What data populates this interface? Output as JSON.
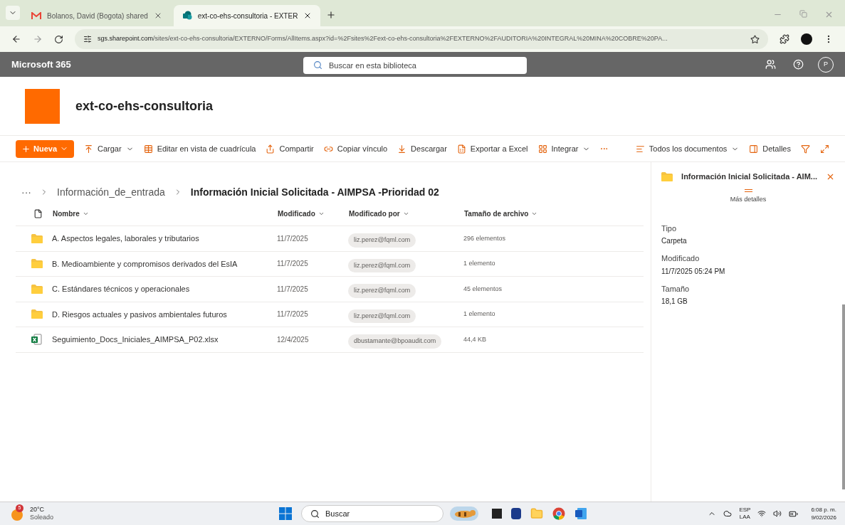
{
  "browser": {
    "tabs": [
      {
        "title": "Bolanos, David (Bogota) shared",
        "kind": "mail",
        "selected": false
      },
      {
        "title": "ext-co-ehs-consultoria - EXTER",
        "kind": "sharepoint",
        "selected": true
      }
    ],
    "url_host": "sgs.sharepoint.com",
    "url_path": "/sites/ext-co-ehs-consultoria/EXTERNO/Forms/AllItems.aspx?id=%2Fsites%2Fext-co-ehs-consultoria%2FEXTERNO%2FAUDITORIA%20INTEGRAL%20MINA%20COBRE%20PA..."
  },
  "suite_bar": {
    "title": "Microsoft 365",
    "search_placeholder": "Buscar en esta biblioteca",
    "avatar": "P"
  },
  "site": {
    "title": "ext-co-ehs-consultoria"
  },
  "command_bar": {
    "new_label": "Nueva",
    "actions": [
      {
        "label": "Cargar",
        "menu": true
      },
      {
        "label": "Editar en vista de cuadrícula",
        "menu": false
      },
      {
        "label": "Compartir",
        "menu": false
      },
      {
        "label": "Copiar vínculo",
        "menu": false
      },
      {
        "label": "Descargar",
        "menu": false
      },
      {
        "label": "Exportar a Excel",
        "menu": false
      },
      {
        "label": "Integrar",
        "menu": true
      }
    ],
    "overflow": "···",
    "view": "Todos los documentos",
    "details": "Detalles"
  },
  "breadcrumb": {
    "ellipsis": "···",
    "items": [
      {
        "label": "Información_de_entrada",
        "selected": false
      },
      {
        "label": "Información Inicial Solicitada - AIMPSA -Prioridad 02",
        "selected": true
      }
    ]
  },
  "table": {
    "columns": [
      "Nombre",
      "Modificado",
      "Modificado por",
      "Tamaño de archivo"
    ],
    "rows": [
      {
        "kind": "folder",
        "name": "A. Aspectos legales, laborales y tributarios",
        "modified": "11/7/2025",
        "modified_by": "liz.perez@fqml.com",
        "size": "296 elementos"
      },
      {
        "kind": "folder",
        "name": "B. Medioambiente y compromisos derivados del EsIA",
        "modified": "11/7/2025",
        "modified_by": "liz.perez@fqml.com",
        "size": "1 elemento"
      },
      {
        "kind": "folder",
        "name": "C. Estándares técnicos y operacionales",
        "modified": "11/7/2025",
        "modified_by": "liz.perez@fqml.com",
        "size": "45 elementos"
      },
      {
        "kind": "folder",
        "name": "D. Riesgos actuales y pasivos ambientales futuros",
        "modified": "11/7/2025",
        "modified_by": "liz.perez@fqml.com",
        "size": "1 elemento"
      },
      {
        "kind": "excel",
        "name": "Seguimiento_Docs_Iniciales_AIMPSA_P02.xlsx",
        "modified": "12/4/2025",
        "modified_by": "dbustamante@bpoaudit.com",
        "size": "44,4 KB"
      }
    ]
  },
  "details_pane": {
    "title": "Información Inicial Solicitada - AIM...",
    "more": "Más detalles",
    "properties": [
      {
        "label": "Tipo",
        "value": "Carpeta"
      },
      {
        "label": "Modificado",
        "value": "11/7/2025 05:24 PM"
      },
      {
        "label": "Tamaño",
        "value": "18,1 GB"
      }
    ]
  },
  "taskbar": {
    "badge": "5",
    "temperature": "20°C",
    "condition": "Soleado",
    "search": "Buscar",
    "lang": "ESP",
    "layout": "LAA",
    "time": "6:08 p. m.",
    "date": "9/02/2026"
  }
}
